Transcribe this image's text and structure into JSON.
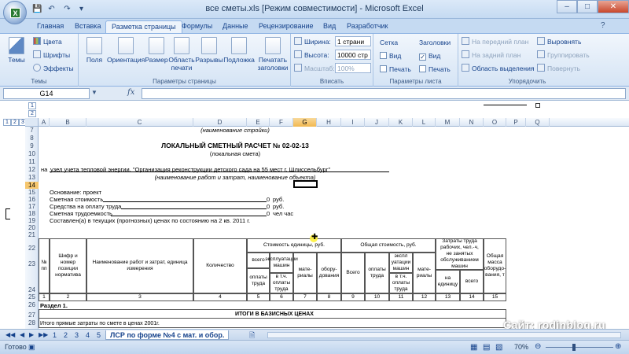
{
  "window": {
    "title": "все сметы.xls  [Режим совместимости] - Microsoft Excel"
  },
  "quick_access": [
    "save-icon",
    "undo-icon",
    "redo-icon",
    "customize-icon"
  ],
  "tabs": [
    "Главная",
    "Вставка",
    "Разметка страницы",
    "Формулы",
    "Данные",
    "Рецензирование",
    "Вид",
    "Разработчик"
  ],
  "active_tab": "Разметка страницы",
  "ribbon": {
    "themes": {
      "big": "Темы",
      "colors": "Цвета",
      "fonts": "Шрифты",
      "effects": "Эффекты",
      "label": "Темы"
    },
    "page_setup": {
      "margins": "Поля",
      "orientation": "Ориентация",
      "size": "Размер",
      "print_area_1": "Область",
      "print_area_2": "печати",
      "breaks": "Разрывы",
      "background": "Подложка",
      "print_titles_1": "Печатать",
      "print_titles_2": "заголовки",
      "label": "Параметры страницы"
    },
    "scale": {
      "width_label": "Ширина:",
      "width_value": "1 страни",
      "height_label": "Высота:",
      "height_value": "10000 стр",
      "scale_label": "Масштаб:",
      "scale_value": "100%",
      "label": "Вписать"
    },
    "sheet_options": {
      "gridlines": "Сетка",
      "headings": "Заголовки",
      "view": "Вид",
      "print": "Печать",
      "label": "Параметры листа"
    },
    "arrange": {
      "bring_front": "На передний план",
      "send_back": "На задний план",
      "selection_pane": "Область выделения",
      "align": "Выровнять",
      "group": "Группировать",
      "rotate": "Повернуть",
      "label": "Упорядочить"
    }
  },
  "formula_bar": {
    "name_box": "G14",
    "fx": "fx",
    "content": ""
  },
  "outline_levels_rows": [
    "1",
    "2",
    "3"
  ],
  "outline_levels_cols": [
    "1",
    "2"
  ],
  "columns": [
    "A",
    "B",
    "C",
    "D",
    "E",
    "F",
    "G",
    "H",
    "I",
    "J",
    "K",
    "L",
    "M",
    "N",
    "O",
    "P",
    "Q"
  ],
  "selected_column": "G",
  "rows": [
    "7",
    "8",
    "9",
    "10",
    "11",
    "12",
    "13",
    "14",
    "15",
    "16",
    "17",
    "18",
    "19",
    "20",
    "21",
    "22",
    "23",
    "24",
    "25",
    "26",
    "27",
    "28"
  ],
  "selected_row": "14",
  "sheet": {
    "r7": "(наименование стройки)",
    "r9_title": "ЛОКАЛЬНЫЙ СМЕТНЫЙ РАСЧЕТ № 02-02-13",
    "r10": "(локальная смета)",
    "r12_na": "на",
    "r12": "узел учета тепловой энергии, \"Организация реконструкции детского сада на 55 мест г. Шлиссельбург\"",
    "r13": "(наименование работ и затрат, наименование объекта)",
    "r15": "Основание: проект",
    "r16": "Сметная стоимость",
    "r16_val": "0",
    "r16_unit": "руб.",
    "r17": "Средства на оплату труда",
    "r17_val": "0",
    "r17_unit": "руб.",
    "r18": "Сметная трудоемкость",
    "r18_val": "0",
    "r18_unit": "чел час",
    "r19": "Составлен(а) в текущих (прогнозных) ценах по состоянию на 2 кв. 2011 г.",
    "h_num": "№ пп",
    "h_code": "Шифр и номер позиции норматива",
    "h_name": "Наименование работ и затрат, единица измерения",
    "h_qty": "Количество",
    "h_unit_cost": "Стоимость единицы, руб.",
    "h_total": "всего",
    "h_labor": "оплаты труда",
    "h_machines": "эксплуатации машин",
    "h_incl_labor": "в т.ч. оплаты труда",
    "h_materials": "мате-риалы",
    "h_total_cost": "Общая стоимость, руб.",
    "h_equipment": "обору-дования",
    "h_total2": "Всего",
    "h_labor2": "оплаты труда",
    "h_machines2": "экспл уатации машин",
    "h_incl_labor2": "в т.ч. оплаты труда",
    "h_materials2": "мате-риалы",
    "h_workers": "Затраты труда рабочих, чел.-ч, не занятых обслуживанием машин",
    "h_per_unit": "на единицу",
    "h_all": "всего",
    "h_mass": "Общая масса оборудо-вания, т",
    "nums": [
      "1",
      "2",
      "3",
      "4",
      "5",
      "6",
      "7",
      "8",
      "9",
      "10",
      "11",
      "12",
      "13",
      "14",
      "15"
    ],
    "r26": "Раздел 1.",
    "r27": "ИТОГИ В БАЗИСНЫХ ЦЕНАХ",
    "r28": "Итого прямые затраты по смете в ценах 2001г."
  },
  "sheet_tabs": {
    "tabs": [
      "1",
      "2",
      "3",
      "4",
      "5"
    ],
    "active": "ЛСР по форме №4 с мат. и обор."
  },
  "status": {
    "ready": "Готово",
    "zoom": "70%"
  },
  "watermark": "Сайт: rodinblog.ru"
}
